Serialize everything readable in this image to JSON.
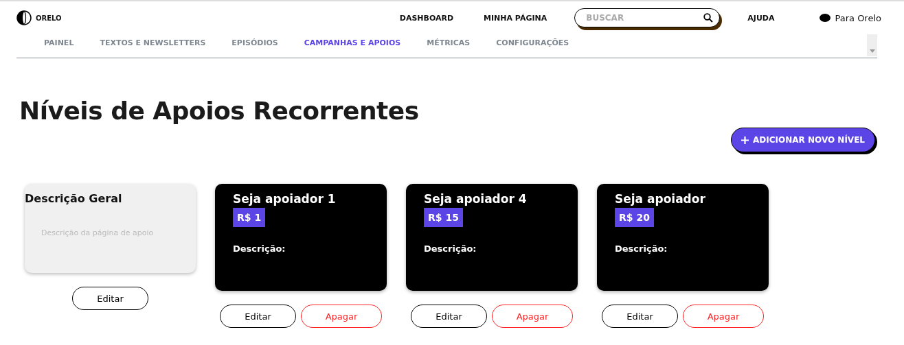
{
  "header": {
    "logo": "ORELO",
    "links": [
      "DASHBOARD",
      "MINHA PÁGINA"
    ],
    "search": {
      "placeholder": "BUSCAR"
    },
    "help": "AJUDA",
    "account": "Para Orelo"
  },
  "tabs": [
    {
      "label": "PAINEL",
      "selected": false
    },
    {
      "label": "TEXTOS E NEWSLETTERS",
      "selected": false
    },
    {
      "label": "EPISÓDIOS",
      "selected": false
    },
    {
      "label": "CAMPANHAS E APOIOS",
      "selected": true
    },
    {
      "label": "MÉTRICAS",
      "selected": false
    },
    {
      "label": "CONFIGURAÇÕES",
      "selected": false
    }
  ],
  "title": "Níveis de Apoios Recorrentes",
  "add_button": "ADICIONAR NOVO NÍVEL",
  "general": {
    "title": "Descrição Geral",
    "placeholder": "Descrição da página de apoio",
    "edit": "Editar"
  },
  "tiers": [
    {
      "name": "Seja apoiador 1",
      "price": "R$ 1",
      "description_label": "Descrição:",
      "edit": "Editar",
      "delete": "Apagar"
    },
    {
      "name": "Seja apoiador 4",
      "price": "R$ 15",
      "description_label": "Descrição:",
      "edit": "Editar",
      "delete": "Apagar"
    },
    {
      "name": "Seja apoiador",
      "price": "R$ 20",
      "description_label": "Descrição:",
      "edit": "Editar",
      "delete": "Apagar"
    }
  ]
}
